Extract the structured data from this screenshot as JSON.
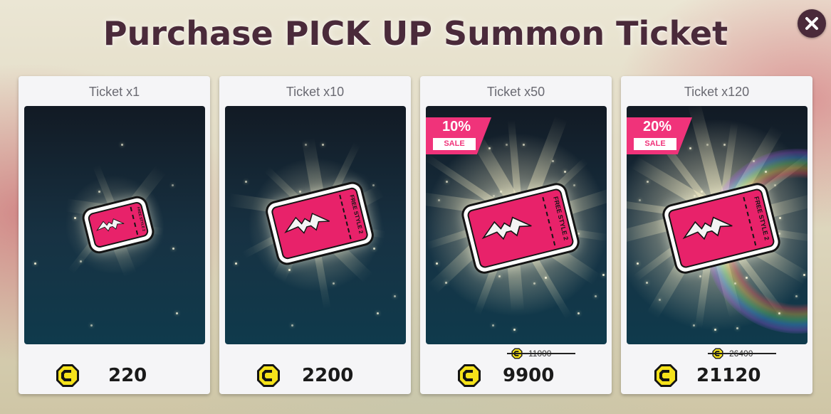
{
  "title": "Purchase PICK UP Summon Ticket",
  "close_icon": "close-x-icon",
  "currency_icon": "coin-c-icon",
  "ticket_strip_text": "FREE STYLE 2",
  "colors": {
    "title": "#4a2a3a",
    "sale": "#f0337a",
    "ticket_pink": "#e8226a",
    "coin_yellow": "#f5e21a"
  },
  "packages": [
    {
      "name": "Ticket x1",
      "price": "220"
    },
    {
      "name": "Ticket x10",
      "price": "2200"
    },
    {
      "name": "Ticket x50",
      "price": "9900",
      "original_price": "11000",
      "discount": "10%",
      "sale_label": "SALE"
    },
    {
      "name": "Ticket x120",
      "price": "21120",
      "original_price": "26400",
      "discount": "20%",
      "sale_label": "SALE"
    }
  ]
}
